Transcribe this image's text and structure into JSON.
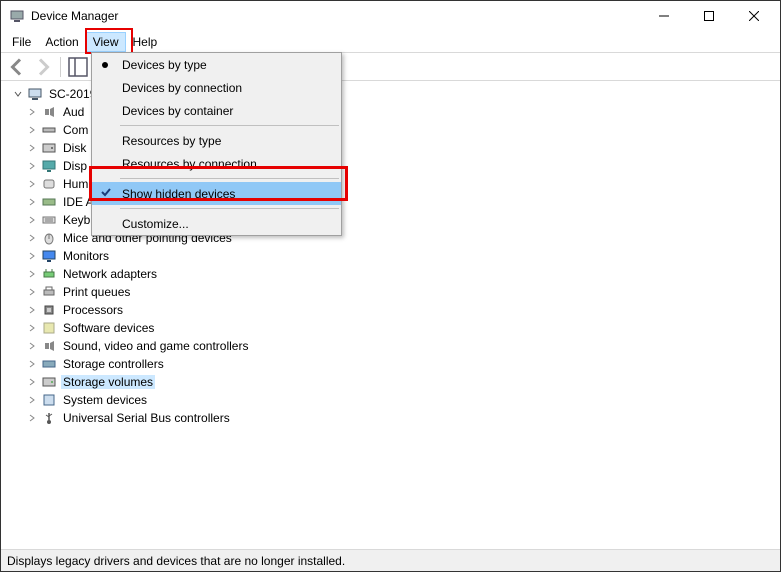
{
  "title": "Device Manager",
  "menu": {
    "file": "File",
    "action": "Action",
    "view": "View",
    "help": "Help"
  },
  "viewMenu": {
    "byType": "Devices by type",
    "byConn": "Devices by connection",
    "byCont": "Devices by container",
    "resType": "Resources by type",
    "resConn": "Resources by connection",
    "showHidden": "Show hidden devices",
    "customize": "Customize..."
  },
  "tree": {
    "root": "SC-2019",
    "items": [
      "Aud",
      "Com",
      "Disk",
      "Disp",
      "Hum",
      "IDE A",
      "Keyb",
      "Mice and other pointing devices",
      "Monitors",
      "Network adapters",
      "Print queues",
      "Processors",
      "Software devices",
      "Sound, video and game controllers",
      "Storage controllers",
      "Storage volumes",
      "System devices",
      "Universal Serial Bus controllers"
    ]
  },
  "status": "Displays legacy drivers and devices that are no longer installed.",
  "icons": {
    "computer": "computer",
    "audio": "speaker",
    "ports": "com",
    "disk": "disk",
    "display": "display",
    "hid": "hid",
    "ide": "ide",
    "keyboard": "keyboard",
    "mouse": "mouse",
    "monitor": "monitor",
    "network": "network",
    "printer": "printer",
    "cpu": "cpu",
    "software": "software",
    "sound": "sound",
    "storagectrl": "storagectrl",
    "storagevol": "storagevol",
    "system": "system",
    "usb": "usb"
  }
}
